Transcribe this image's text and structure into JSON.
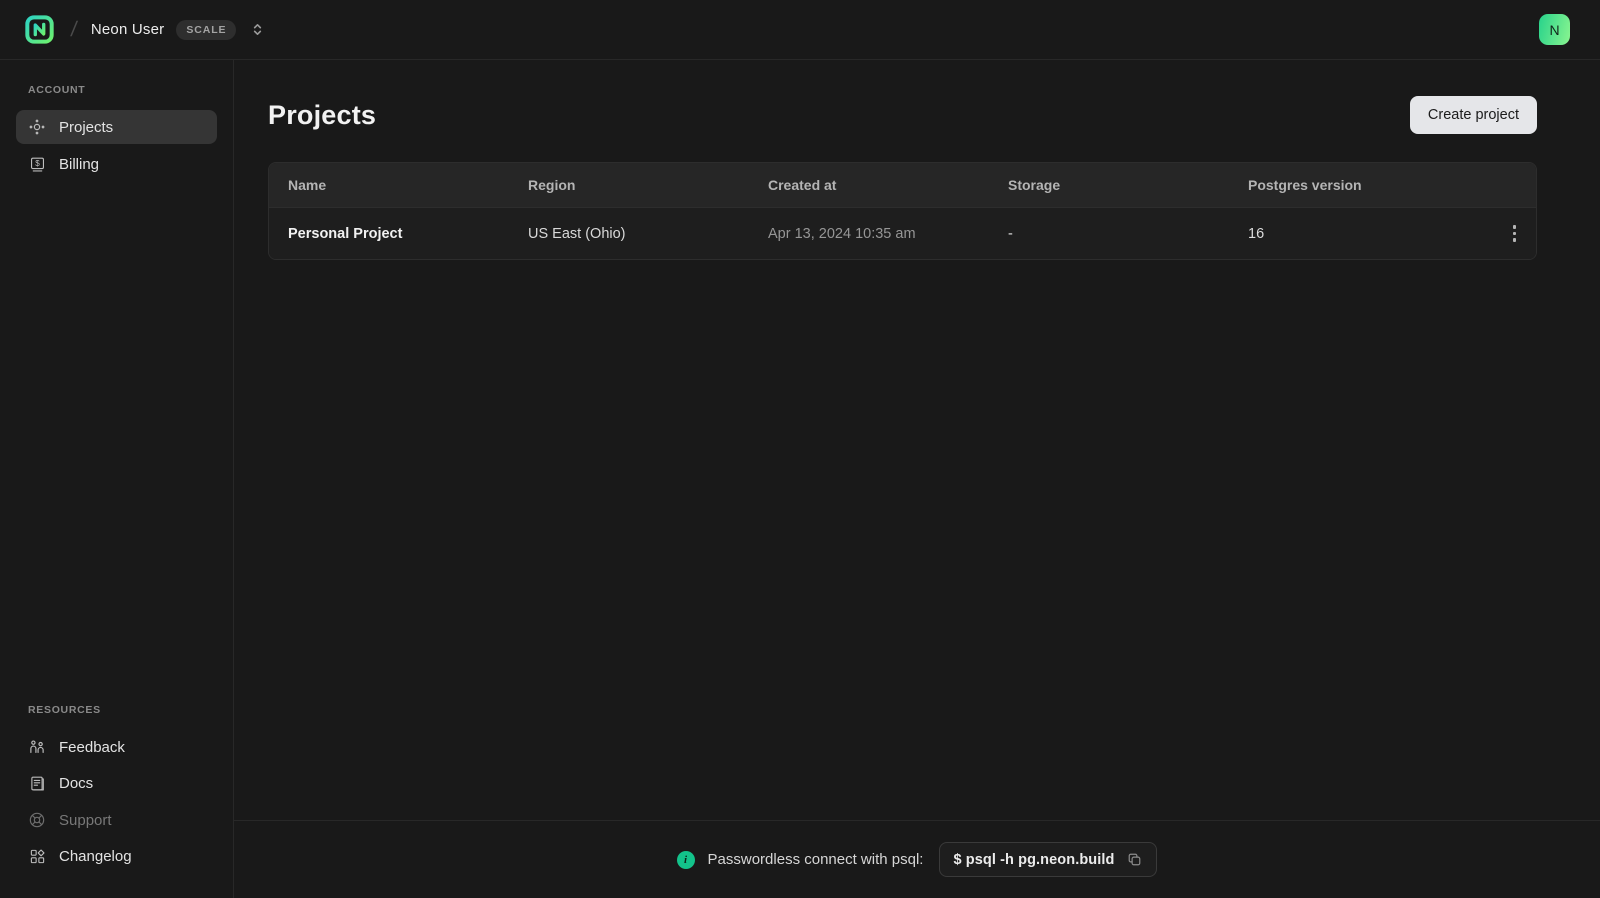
{
  "header": {
    "org_name": "Neon User",
    "plan_badge": "SCALE",
    "avatar_initial": "N"
  },
  "sidebar": {
    "account_label": "ACCOUNT",
    "account_items": [
      {
        "label": "Projects",
        "icon": "projects-icon",
        "active": true
      },
      {
        "label": "Billing",
        "icon": "billing-icon",
        "active": false
      }
    ],
    "resources_label": "RESOURCES",
    "resource_items": [
      {
        "label": "Feedback",
        "icon": "feedback-icon"
      },
      {
        "label": "Docs",
        "icon": "docs-icon"
      },
      {
        "label": "Support",
        "icon": "support-icon",
        "dimmed": true
      },
      {
        "label": "Changelog",
        "icon": "changelog-icon"
      }
    ]
  },
  "main": {
    "title": "Projects",
    "create_button": "Create project",
    "table": {
      "columns": [
        "Name",
        "Region",
        "Created at",
        "Storage",
        "Postgres version"
      ],
      "rows": [
        {
          "name": "Personal Project",
          "region": "US East (Ohio)",
          "created_at": "Apr 13, 2024 10:35 am",
          "storage": "-",
          "postgres_version": "16"
        }
      ]
    }
  },
  "footer": {
    "info_text": "Passwordless connect with psql:",
    "command": "$ psql -h pg.neon.build"
  },
  "colors": {
    "background": "#191919",
    "border": "#282828",
    "brand_green": "#00e599",
    "brand_gradient_start": "#2ed3c2",
    "brand_gradient_end": "#6ef16d",
    "active_item_bg": "#353535",
    "create_button_bg": "#e5e6e9",
    "info_icon_bg": "#13c38b"
  }
}
